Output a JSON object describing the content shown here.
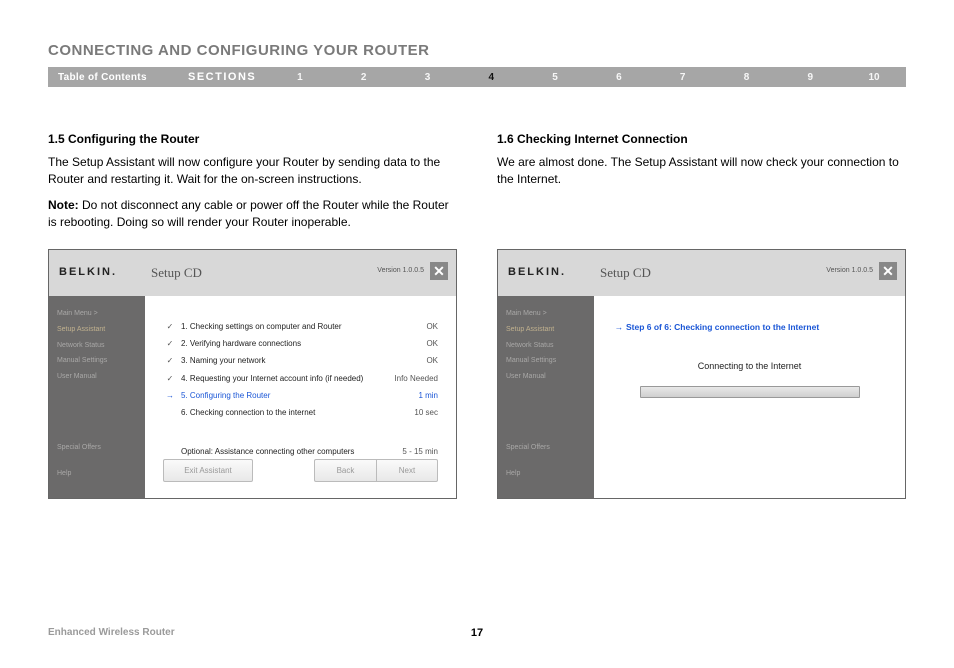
{
  "title": "CONNECTING AND CONFIGURING YOUR ROUTER",
  "nav": {
    "toc": "Table of Contents",
    "sections": "SECTIONS",
    "nums": [
      "1",
      "2",
      "3",
      "4",
      "5",
      "6",
      "7",
      "8",
      "9",
      "10"
    ],
    "active": "4"
  },
  "left": {
    "heading": "1.5 Configuring the Router",
    "p1": "The Setup Assistant will now configure your Router by sending data to the Router and restarting it. Wait for the on-screen instructions.",
    "noteLabel": "Note:",
    "noteText": " Do not disconnect any cable or power off the Router while the Router is rebooting. Doing so will render your Router inoperable."
  },
  "right": {
    "heading": "1.6 Checking Internet Connection",
    "p1": "We are almost done. The Setup Assistant will now check your connection to the Internet."
  },
  "shot": {
    "brand": "BELKIN.",
    "app": "Setup CD",
    "version": "Version 1.0.0.5",
    "side": {
      "main": "Main Menu  >",
      "setup": "Setup Assistant",
      "net": "Network Status",
      "man": "Manual Settings",
      "usr": "User Manual",
      "off": "Special Offers",
      "help": "Help"
    },
    "steps": [
      {
        "ic": "✓",
        "txt": "1. Checking settings on computer and Router",
        "st": "OK"
      },
      {
        "ic": "✓",
        "txt": "2. Verifying hardware connections",
        "st": "OK"
      },
      {
        "ic": "✓",
        "txt": "3. Naming your network",
        "st": "OK"
      },
      {
        "ic": "✓",
        "txt": "4. Requesting your Internet account info (if needed)",
        "st": "Info Needed"
      },
      {
        "ic": "→",
        "txt": "5. Configuring the Router",
        "st": "1 min",
        "cur": true
      },
      {
        "ic": "",
        "txt": "6. Checking connection to the internet",
        "st": "10 sec"
      }
    ],
    "optional": {
      "txt": "Optional: Assistance connecting other computers",
      "st": "5 - 15 min"
    },
    "buttons": {
      "exit": "Exit Assistant",
      "back": "Back",
      "next": "Next"
    }
  },
  "shot2": {
    "step": "Step 6 of 6: Checking connection to the Internet",
    "msg": "Connecting to the Internet"
  },
  "footer": {
    "product": "Enhanced Wireless Router",
    "page": "17"
  }
}
